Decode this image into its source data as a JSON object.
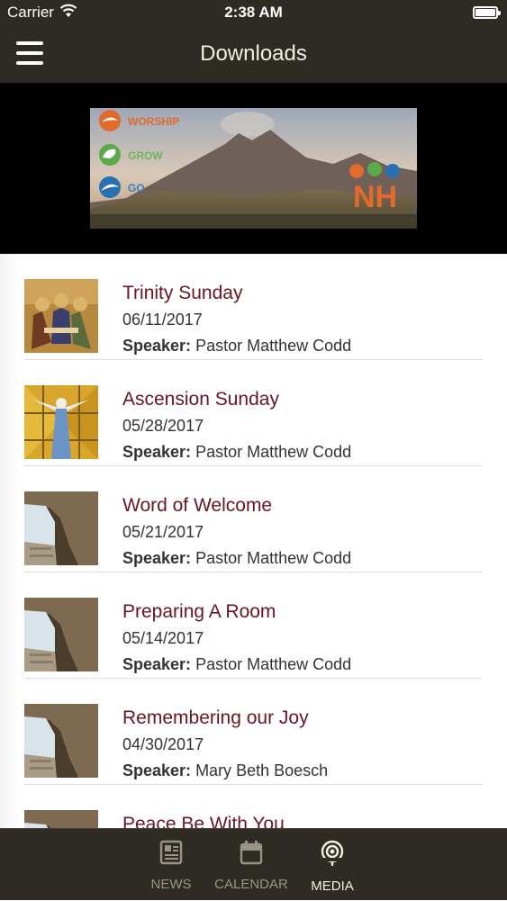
{
  "status": {
    "carrier": "Carrier",
    "time": "2:38 AM"
  },
  "header": {
    "title": "Downloads"
  },
  "banner": {
    "words": [
      "WORSHIP",
      "GROW",
      "GO"
    ],
    "logo_text": "NH"
  },
  "items": [
    {
      "title": "Trinity Sunday",
      "date": "06/11/2017",
      "speaker_label": "Speaker:",
      "speaker": "Pastor Matthew Codd",
      "thumb": "trinity-icon"
    },
    {
      "title": "Ascension Sunday",
      "date": "05/28/2017",
      "speaker_label": "Speaker:",
      "speaker": "Pastor Matthew Codd",
      "thumb": "ascension-icon"
    },
    {
      "title": "Word of Welcome",
      "date": "05/21/2017",
      "speaker_label": "Speaker:",
      "speaker": "Pastor Matthew Codd",
      "thumb": "tomb-icon"
    },
    {
      "title": "Preparing A Room",
      "date": "05/14/2017",
      "speaker_label": "Speaker:",
      "speaker": "Pastor Matthew Codd",
      "thumb": "tomb-icon"
    },
    {
      "title": "Remembering our Joy",
      "date": "04/30/2017",
      "speaker_label": "Speaker:",
      "speaker": "Mary Beth Boesch",
      "thumb": "tomb-icon"
    },
    {
      "title": "Peace Be With You",
      "date": "",
      "speaker_label": "",
      "speaker": "",
      "thumb": "tomb-icon"
    }
  ],
  "tabs": [
    {
      "label": "NEWS",
      "icon": "newspaper-icon",
      "active": false
    },
    {
      "label": "CALENDAR",
      "icon": "calendar-icon",
      "active": false
    },
    {
      "label": "MEDIA",
      "icon": "podcast-icon",
      "active": true
    }
  ],
  "colors": {
    "bar": "#2d2b24",
    "title_accent": "#6b1423",
    "banner_orange": "#e26a2c"
  }
}
